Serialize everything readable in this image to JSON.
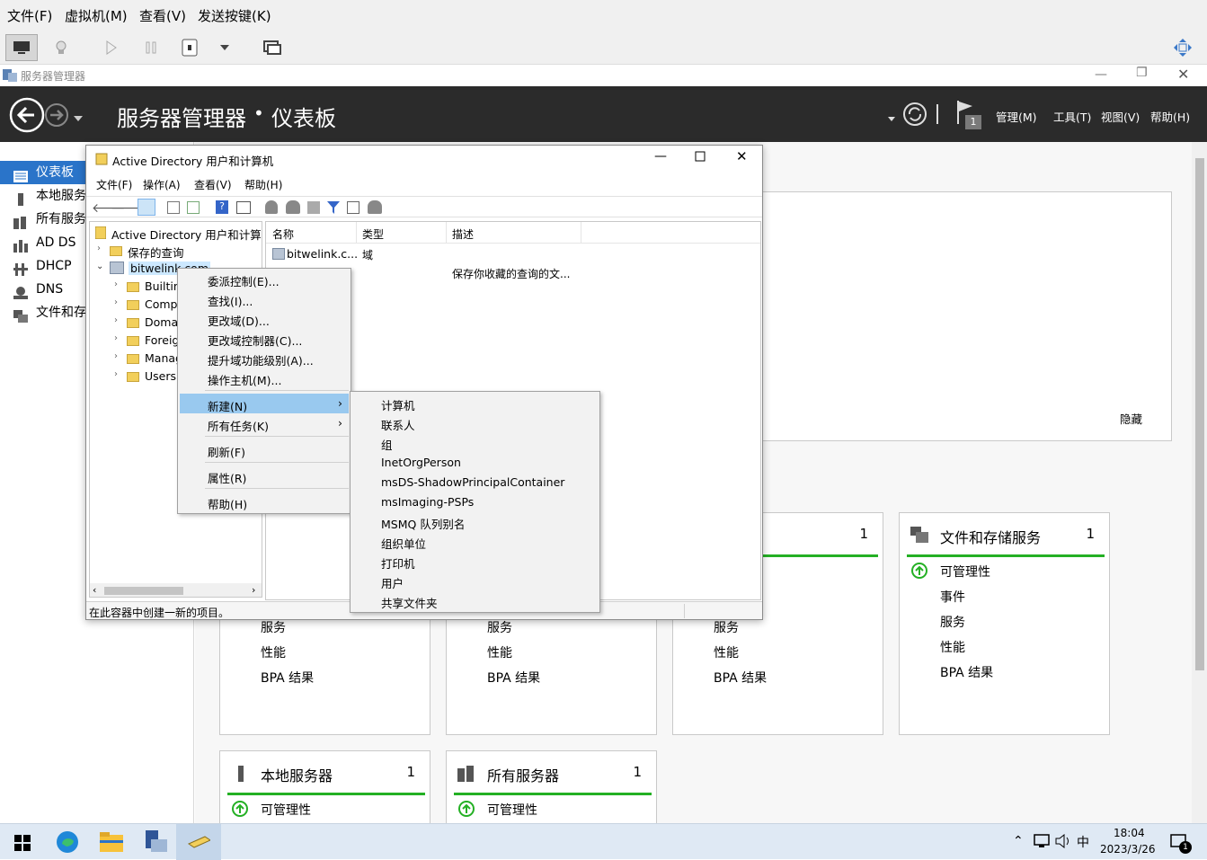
{
  "vm": {
    "menu": [
      "文件(F)",
      "虚拟机(M)",
      "查看(V)",
      "发送按键(K)"
    ]
  },
  "server_manager": {
    "window_title": "服务器管理器",
    "breadcrumb_root": "服务器管理器",
    "breadcrumb_sep": "•",
    "breadcrumb_page": "仪表板",
    "menu": [
      "管理(M)",
      "工具(T)",
      "视图(V)",
      "帮助(H)"
    ],
    "flag_count": "1",
    "nav": [
      "仪表板",
      "本地服务器",
      "所有服务器",
      "AD DS",
      "DHCP",
      "DNS",
      "文件和存储服务"
    ],
    "hide_label": "隐藏",
    "tiles": [
      {
        "title": "文件和存储服务",
        "count": "1",
        "rows": [
          "可管理性",
          "事件",
          "服务",
          "性能",
          "BPA 结果"
        ]
      },
      {
        "title": "",
        "count": "1",
        "rows": [
          "服务",
          "性能",
          "BPA 结果"
        ]
      },
      {
        "title": "本地服务器",
        "count": "1",
        "rows": [
          "可管理性"
        ]
      },
      {
        "title": "所有服务器",
        "count": "1",
        "rows": [
          "可管理性"
        ]
      }
    ],
    "partial_rows": [
      "服务",
      "性能",
      "BPA 结果"
    ]
  },
  "aduc": {
    "title": "Active Directory 用户和计算机",
    "menu": [
      "文件(F)",
      "操作(A)",
      "查看(V)",
      "帮助(H)"
    ],
    "tree_root": "Active Directory 用户和计算机",
    "tree": [
      "保存的查询",
      "bitwelink.com",
      "Builtin",
      "Comp",
      "Doma",
      "Foreig",
      "Manag",
      "Users"
    ],
    "columns": [
      "名称",
      "类型",
      "描述"
    ],
    "rows": [
      {
        "name": "bitwelink.c...",
        "type": "域",
        "desc": ""
      },
      {
        "name": "",
        "type": "",
        "desc": "保存你收藏的查询的文..."
      }
    ],
    "status": "在此容器中创建一新的项目。"
  },
  "context_menu": {
    "items": [
      "委派控制(E)...",
      "查找(I)...",
      "更改域(D)...",
      "更改域控制器(C)...",
      "提升域功能级别(A)...",
      "操作主机(M)...",
      "新建(N)",
      "所有任务(K)",
      "刷新(F)",
      "属性(R)",
      "帮助(H)"
    ]
  },
  "submenu": {
    "items": [
      "计算机",
      "联系人",
      "组",
      "InetOrgPerson",
      "msDS-ShadowPrincipalContainer",
      "msImaging-PSPs",
      "MSMQ 队列别名",
      "组织单位",
      "打印机",
      "用户",
      "共享文件夹"
    ]
  },
  "taskbar": {
    "time": "18:04",
    "date": "2023/3/26",
    "ime": "中",
    "notify_count": "1"
  },
  "colors": {
    "accent": "#0078d7",
    "header_bg": "#2b2b2b",
    "green": "#24b024",
    "selected": "#99c9ef"
  }
}
